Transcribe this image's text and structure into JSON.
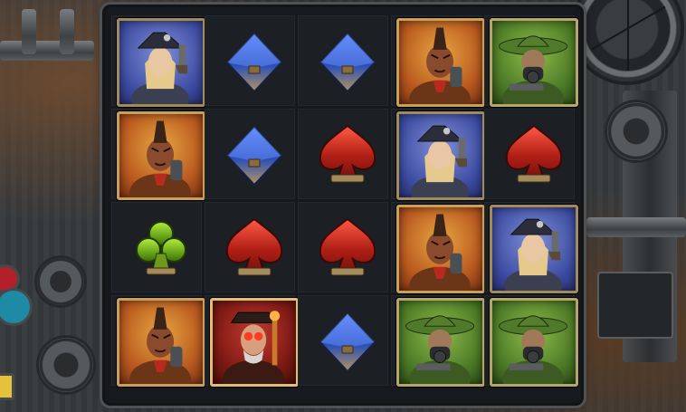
{
  "game": {
    "symbol_types": {
      "gunslinger": {
        "icon": "gunslinger-woman-icon",
        "frame_color": "#4a5bb8"
      },
      "brute": {
        "icon": "mohawk-brute-icon",
        "frame_color": "#c66a22"
      },
      "masked": {
        "icon": "gasmask-ranger-icon",
        "frame_color": "#4f8a2a"
      },
      "boss": {
        "icon": "gentleman-boss-icon",
        "frame_color": "#9c2218"
      },
      "diamond": {
        "icon": "diamond-suit-icon",
        "color": "#3a5fd0"
      },
      "spade": {
        "icon": "spade-suit-icon",
        "color": "#d12d22"
      },
      "club": {
        "icon": "club-suit-icon",
        "color": "#7fbf24"
      }
    },
    "grid": [
      [
        "gunslinger",
        "diamond",
        "diamond",
        "brute",
        "masked"
      ],
      [
        "brute",
        "diamond",
        "spade",
        "gunslinger",
        "spade"
      ],
      [
        "club",
        "spade",
        "spade",
        "brute",
        "gunslinger"
      ],
      [
        "brute",
        "boss",
        "diamond",
        "masked",
        "masked"
      ]
    ]
  }
}
